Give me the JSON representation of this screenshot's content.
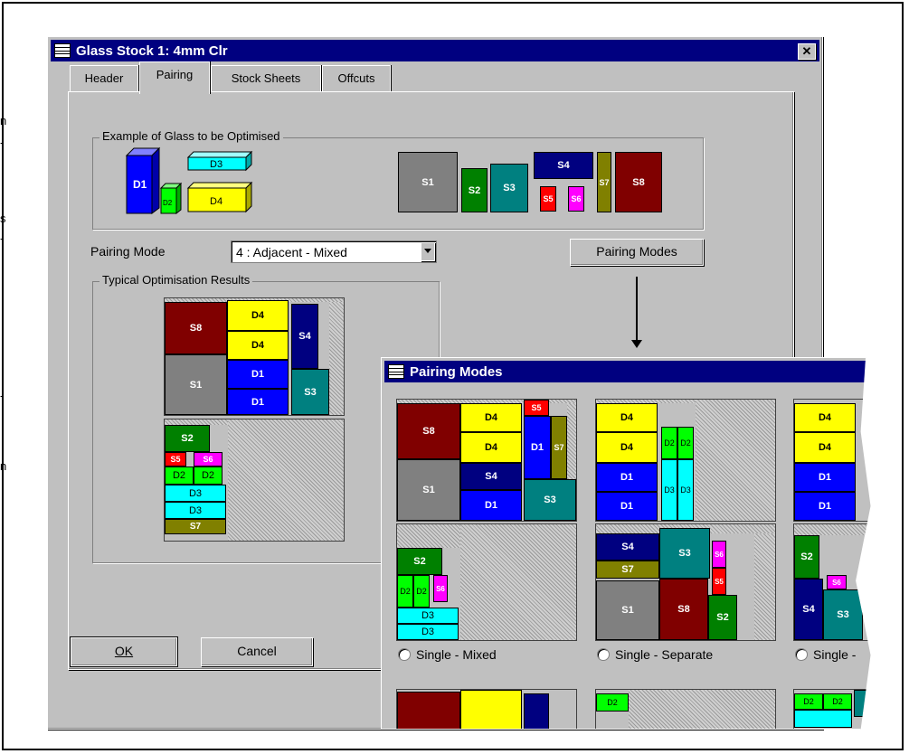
{
  "edge_chars": [
    "n",
    "-",
    "s",
    "-",
    "-",
    "n"
  ],
  "main_window": {
    "title": "Glass Stock 1: 4mm Clr",
    "tabs": [
      "Header",
      "Pairing",
      "Stock Sheets",
      "Offcuts"
    ],
    "active_tab": "Pairing"
  },
  "example_group": {
    "label": "Example of Glass to be Optimised",
    "double_units": [
      "D1",
      "D2",
      "D3",
      "D4"
    ],
    "singles": [
      "S1",
      "S2",
      "S3",
      "S4",
      "S5",
      "S6",
      "S7",
      "S8"
    ]
  },
  "pairing_mode": {
    "label": "Pairing Mode",
    "selected": "4 : Adjacent - Mixed",
    "button_label": "Pairing Modes"
  },
  "results_group": {
    "label": "Typical Optimisation Results"
  },
  "footer": {
    "ok_label": "OK",
    "cancel_label": "Cancel"
  },
  "pairing_modes_window": {
    "title": "Pairing Modes",
    "options": [
      "Single - Mixed",
      "Single - Separate",
      "Single - "
    ]
  },
  "piece_labels": {
    "d1": "D1",
    "d2": "D2",
    "d3": "D3",
    "d4": "D4",
    "s1": "S1",
    "s2": "S2",
    "s3": "S3",
    "s4": "S4",
    "s5": "S5",
    "s6": "S6",
    "s7": "S7",
    "s8": "S8"
  },
  "colors": {
    "d1": "#0000ff",
    "d2": "#00ff00",
    "d3": "#00ffff",
    "d4": "#ffff00",
    "s1": "#808080",
    "s2": "#008000",
    "s3": "#008080",
    "s4": "#000080",
    "s5": "#ff0000",
    "s6": "#ff00ff",
    "s7": "#808000",
    "s8": "#800000",
    "title_bar": "#000080",
    "window_face": "#c0c0c0"
  }
}
